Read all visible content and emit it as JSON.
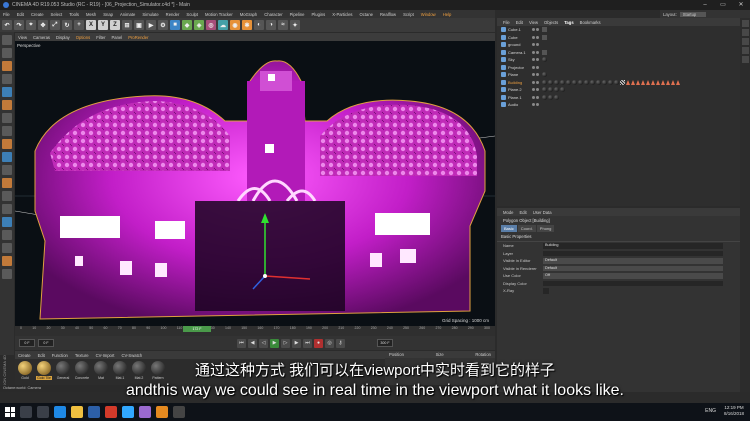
{
  "window": {
    "title": "CINEMA 4D R19.053 Studio (RC - R19) - [06_Projection_Simulator.c4d *] - Main",
    "controls": [
      "–",
      "▭",
      "✕"
    ]
  },
  "menubar": [
    "File",
    "Edit",
    "Create",
    "Select",
    "Tools",
    "Mesh",
    "Snap",
    "Animate",
    "Simulate",
    "Render",
    "Sculpt",
    "Motion Tracker",
    "MoGraph",
    "Character",
    "Pipeline",
    "Plugins",
    "X-Particles",
    "Octane",
    "Realflow",
    "Script",
    "Window",
    "Help"
  ],
  "layout": {
    "label": "Layout:",
    "value": "Startup"
  },
  "toolbar": {
    "axis_labels": [
      "X",
      "Y",
      "Z"
    ]
  },
  "viewport": {
    "menu": [
      "View",
      "Cameras",
      "Display",
      "Options",
      "Filter",
      "Panel",
      "ProRender"
    ],
    "label": "Perspective",
    "grid_spacing": "Grid Spacing : 1000 cm"
  },
  "timeline": {
    "ticks": [
      "0",
      "10",
      "20",
      "30",
      "40",
      "50",
      "60",
      "70",
      "80",
      "90",
      "100",
      "110",
      "120",
      "130",
      "140",
      "150",
      "160",
      "170",
      "180",
      "190",
      "200",
      "210",
      "220",
      "230",
      "240",
      "250",
      "260",
      "270",
      "280",
      "290",
      "300"
    ],
    "current": "172 F",
    "start_frame": "0 F",
    "end_frame": "300 F"
  },
  "material_manager": {
    "menu": [
      "Create",
      "Edit",
      "Function",
      "Texture",
      "CV-Import",
      "CV-Swatch"
    ],
    "materials": [
      {
        "name": "Gold",
        "selected": false
      },
      {
        "name": "Gold Tile",
        "selected": true
      },
      {
        "name": "General",
        "selected": false
      },
      {
        "name": "Concrete",
        "selected": false
      },
      {
        "name": "Mat",
        "selected": false
      },
      {
        "name": "Mat.1",
        "selected": false
      },
      {
        "name": "Mat.2",
        "selected": false
      },
      {
        "name": "Pattern",
        "selected": false
      }
    ],
    "side_label": "MAXON CINEMA 4D"
  },
  "coordinates": {
    "position": "Position",
    "size": "Size",
    "rotation": "Rotation"
  },
  "status": "Octane:world: Camera",
  "object_manager": {
    "menu": [
      "File",
      "Edit",
      "View",
      "Objects",
      "Tags",
      "Bookmarks"
    ],
    "active_menu": "Tags",
    "objects": [
      {
        "name": "Cube.1",
        "selected": false,
        "tags": [
          "x"
        ]
      },
      {
        "name": "Cube",
        "selected": false,
        "tags": [
          "x"
        ]
      },
      {
        "name": "ground",
        "selected": false,
        "tags": []
      },
      {
        "name": "Camera.1",
        "selected": false,
        "tags": [
          "x"
        ]
      },
      {
        "name": "Sky",
        "selected": false,
        "tags": [
          "ball"
        ]
      },
      {
        "name": "Projector",
        "selected": false,
        "tags": []
      },
      {
        "name": "Plane",
        "selected": false,
        "tags": [
          "ball"
        ]
      },
      {
        "name": "Building",
        "selected": true,
        "tags": [
          "ball",
          "ball",
          "ball",
          "ball",
          "ball",
          "ball",
          "ball",
          "ball",
          "ball",
          "ball",
          "ball",
          "ball",
          "ball",
          "chk",
          "tri",
          "tri",
          "tri",
          "tri",
          "tri",
          "tri",
          "tri",
          "tri",
          "tri",
          "tri",
          "tri"
        ]
      },
      {
        "name": "Plane.2",
        "selected": false,
        "tags": [
          "ball",
          "ball",
          "ball",
          "ball"
        ]
      },
      {
        "name": "Plane.1",
        "selected": false,
        "tags": [
          "ball",
          "ball",
          "ball"
        ]
      },
      {
        "name": "Audio",
        "selected": false,
        "tags": []
      }
    ]
  },
  "attribute_manager": {
    "menu": [
      "Mode",
      "Edit",
      "User Data"
    ],
    "object_title": "Polygon Object [Building]",
    "tabs": [
      {
        "label": "Basic",
        "selected": true
      },
      {
        "label": "Coord.",
        "selected": false
      },
      {
        "label": "Phong",
        "selected": false
      }
    ],
    "section": "Basic Properties",
    "props": [
      {
        "label": "Name",
        "value": "Building",
        "type": "text"
      },
      {
        "label": "Layer",
        "value": "",
        "type": "text"
      },
      {
        "label": "Visible in Editor",
        "value": "Default",
        "type": "dropdown"
      },
      {
        "label": "Visible in Renderer",
        "value": "Default",
        "type": "dropdown"
      },
      {
        "label": "Use Color",
        "value": "Off",
        "type": "dropdown"
      },
      {
        "label": "Display Color",
        "value": "",
        "type": "text"
      },
      {
        "label": "X-Ray",
        "value": "",
        "type": "checkbox"
      }
    ]
  },
  "subtitles": {
    "chinese": "通过这种方式 我们可以在viewport中实时看到它的样子",
    "english": "andthis way we could see in real time in the viewport what it looks like."
  },
  "taskbar": {
    "language": "ENG",
    "time": "12:19 PM",
    "date": "8/16/2018"
  },
  "colors": {
    "accent": "#f0a040",
    "neon_magenta": "#e040e0",
    "selected_tab": "#5a7ea8"
  }
}
